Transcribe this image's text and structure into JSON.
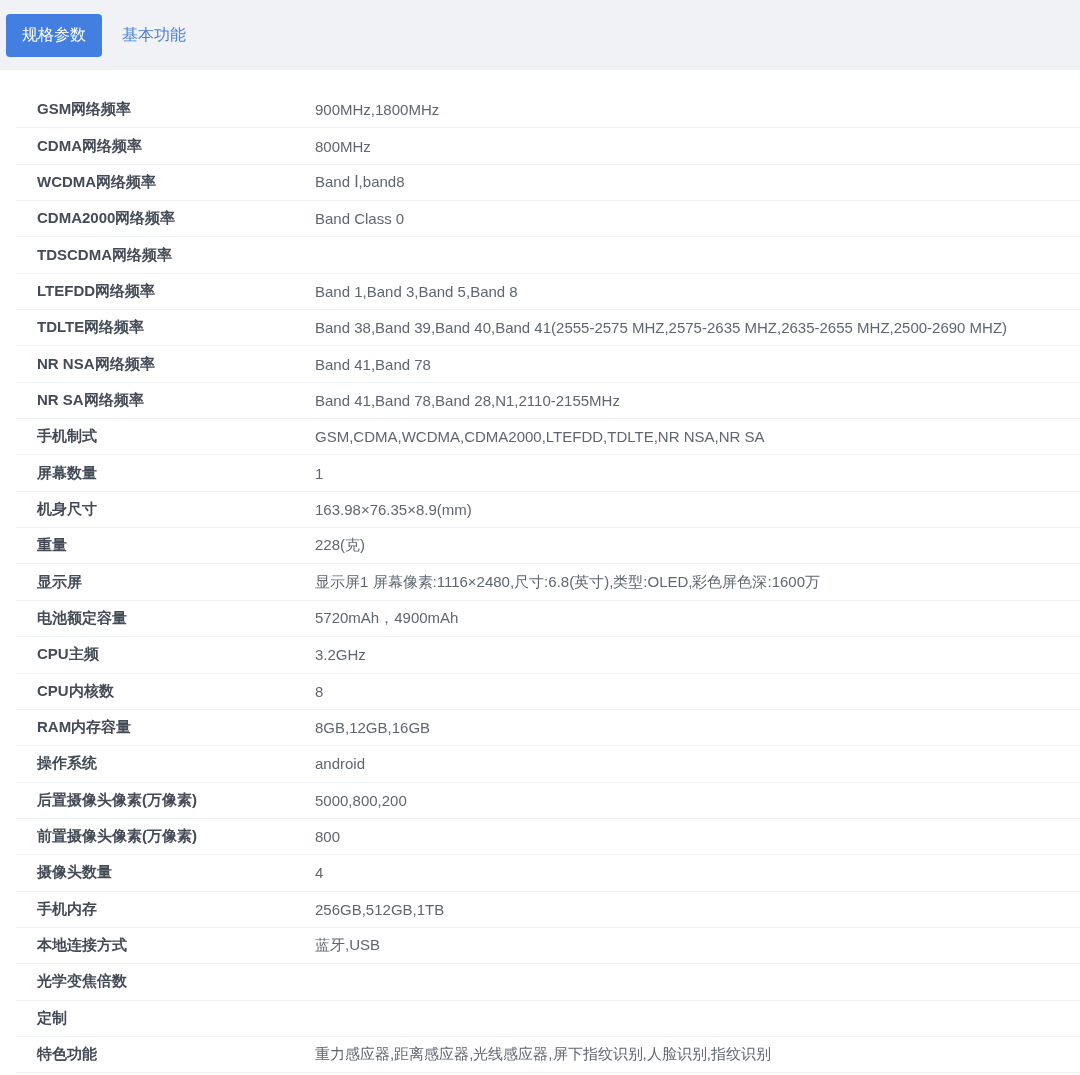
{
  "tabs": [
    {
      "label": "规格参数",
      "selected": true
    },
    {
      "label": "基本功能",
      "selected": false
    }
  ],
  "specs": [
    {
      "label": "GSM网络频率",
      "value": "900MHz,1800MHz"
    },
    {
      "label": "CDMA网络频率",
      "value": "800MHz"
    },
    {
      "label": "WCDMA网络频率",
      "value": "Band Ⅰ,band8"
    },
    {
      "label": "CDMA2000网络频率",
      "value": "Band Class 0"
    },
    {
      "label": "TDSCDMA网络频率"
    },
    {
      "label": "LTEFDD网络频率",
      "value": "Band 1,Band 3,Band 5,Band 8"
    },
    {
      "label": "TDLTE网络频率",
      "value": "Band 38,Band 39,Band 40,Band 41(2555-2575 MHZ,2575-2635 MHZ,2635-2655 MHZ,2500-2690 MHZ)"
    },
    {
      "label": "NR NSA网络频率",
      "value": "Band 41,Band 78"
    },
    {
      "label": "NR SA网络频率",
      "value": "Band 41,Band 78,Band 28,N1,2110-2155MHz"
    },
    {
      "label": "手机制式",
      "value": "GSM,CDMA,WCDMA,CDMA2000,LTEFDD,TDLTE,NR NSA,NR SA"
    },
    {
      "label": "屏幕数量",
      "value": "1"
    },
    {
      "label": "机身尺寸",
      "value": "163.98×76.35×8.9(mm)"
    },
    {
      "label": "重量",
      "value": "228(克)"
    },
    {
      "label": "显示屏",
      "value": "显示屏1 屏幕像素:1116×2480,尺寸:6.8(英寸),类型:OLED,彩色屏色深:1600万"
    },
    {
      "label": "电池额定容量",
      "value": "5720mAh，4900mAh"
    },
    {
      "label": "CPU主频",
      "value": "3.2GHz"
    },
    {
      "label": "CPU内核数",
      "value": "8"
    },
    {
      "label": "RAM内存容量",
      "value": "8GB,12GB,16GB"
    },
    {
      "label": "操作系统",
      "value": "android"
    },
    {
      "label": "后置摄像头像素(万像素)",
      "value": "5000,800,200"
    },
    {
      "label": "前置摄像头像素(万像素)",
      "value": "800"
    },
    {
      "label": "摄像头数量",
      "value": "4"
    },
    {
      "label": "手机内存",
      "value": "256GB,512GB,1TB"
    },
    {
      "label": "本地连接方式",
      "value": "蓝牙,USB"
    },
    {
      "label": "光学变焦倍数"
    },
    {
      "label": "定制"
    },
    {
      "label": "特色功能",
      "value": "重力感应器,距离感应器,光线感应器,屏下指纹识别,人脸识别,指纹识别"
    }
  ]
}
